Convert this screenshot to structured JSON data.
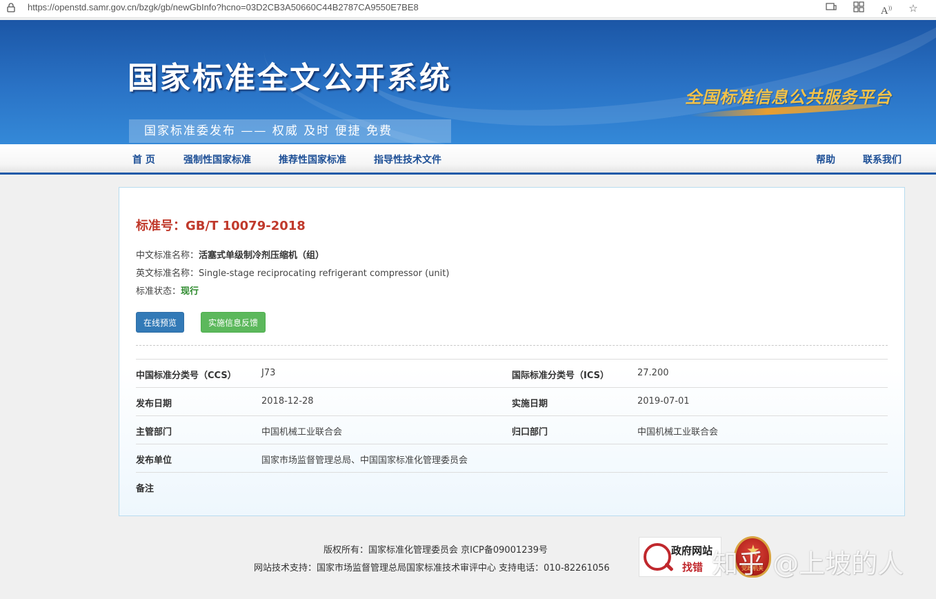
{
  "browser": {
    "url": "https://openstd.samr.gov.cn/bzgk/gb/newGbInfo?hcno=03D2CB3A50660C44B2787CA9550E7BE8",
    "icons": [
      "lock-icon",
      "reader-mode-icon",
      "apps-icon",
      "read-aloud-icon",
      "favorite-star-icon"
    ]
  },
  "banner": {
    "title": "国家标准全文公开系统",
    "slogan": "国家标准委发布 —— 权威 及时 便捷 免费",
    "platform": "全国标准信息公共服务平台"
  },
  "nav": {
    "home": "首 页",
    "mandatory": "强制性国家标准",
    "recommended": "推荐性国家标准",
    "guidance": "指导性技术文件",
    "help": "帮助",
    "contact": "联系我们"
  },
  "standard": {
    "number": "标准号：GB/T 10079-2018",
    "cn_name_label": "中文标准名称：",
    "cn_name": "活塞式单级制冷剂压缩机（组）",
    "en_name_label": "英文标准名称：",
    "en_name": "Single-stage reciprocating refrigerant compressor (unit)",
    "status_label": "标准状态：",
    "status": "现行",
    "preview_button": "在线预览",
    "feedback_button": "实施信息反馈"
  },
  "details": {
    "ccs_label": "中国标准分类号（CCS）",
    "ccs": "J73",
    "ics_label": "国际标准分类号（ICS）",
    "ics": "27.200",
    "publish_date_label": "发布日期",
    "publish_date": "2018-12-28",
    "implement_date_label": "实施日期",
    "implement_date": "2019-07-01",
    "supervisor_label": "主管部门",
    "supervisor": "中国机械工业联合会",
    "centralized_label": "归口部门",
    "centralized": "中国机械工业联合会",
    "publisher_label": "发布单位",
    "publisher": "国家市场监督管理总局、中国国家标准化管理委员会",
    "remarks_label": "备注",
    "remarks": ""
  },
  "footer": {
    "copyright": "版权所有：国家标准化管理委员会 京ICP备09001239号",
    "support": "网站技术支持：国家市场监督管理总局国家标准技术审评中心 支持电话：010-82261056",
    "gov_badge_line1": "政府网站",
    "gov_badge_line2": "找错",
    "party_badge_text": "党政机关",
    "watermark": "知乎 @上坡的人"
  },
  "colors": {
    "banner_blue": "#2a73c6",
    "nav_text": "#1d4f96",
    "standard_number_red": "#c0392b",
    "status_green": "#2e8b2e",
    "button_blue": "#337ab7",
    "button_green": "#5cb85c"
  }
}
